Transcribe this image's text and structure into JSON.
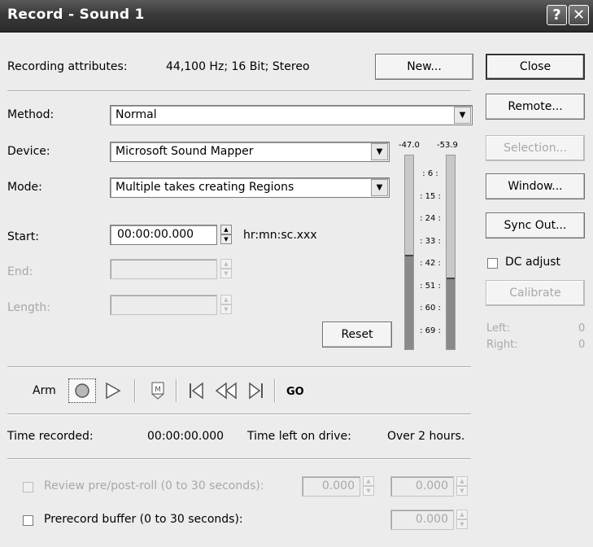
{
  "window": {
    "title": "Record - Sound 1",
    "help_glyph": "?",
    "close_glyph": "✕"
  },
  "attributes": {
    "label": "Recording attributes:",
    "value": "44,100 Hz; 16 Bit; Stereo",
    "new_button": "New..."
  },
  "form": {
    "method_label": "Method:",
    "method_value": "Normal",
    "device_label": "Device:",
    "device_value": "Microsoft Sound Mapper",
    "mode_label": "Mode:",
    "mode_value": "Multiple takes creating Regions",
    "start_label": "Start:",
    "start_value": "00:00:00.000",
    "time_format": "hr:mn:sc.xxx",
    "end_label": "End:",
    "end_value": "",
    "length_label": "Length:",
    "length_value": "",
    "reset_button": "Reset"
  },
  "meters": {
    "left_peak": "-47.0",
    "right_peak": "-53.9",
    "scale": [
      "6",
      "15",
      "24",
      "33",
      "42",
      "51",
      "60",
      "69"
    ],
    "left_level": 0.48,
    "right_level": 0.36
  },
  "side": {
    "close": "Close",
    "remote": "Remote...",
    "selection": "Selection...",
    "window": "Window...",
    "sync_out": "Sync Out...",
    "dc_adjust": "DC adjust",
    "calibrate": "Calibrate",
    "left_label": "Left:",
    "left_value": "0",
    "right_label": "Right:",
    "right_value": "0"
  },
  "transport": {
    "arm": "Arm",
    "go": "GO",
    "icons": [
      "record-icon",
      "play-icon",
      "marker-icon",
      "go-to-start-icon",
      "rewind-icon",
      "go-to-end-icon"
    ]
  },
  "status": {
    "time_recorded_label": "Time recorded:",
    "time_recorded_value": "00:00:00.000",
    "time_left_label": "Time left on drive:",
    "time_left_value": "Over 2 hours."
  },
  "options": {
    "review_label": "Review pre/post-roll (0 to 30 seconds):",
    "review_pre": "0.000",
    "review_post": "0.000",
    "prerecord_label": "Prerecord buffer (0 to 30 seconds):",
    "prerecord_value": "0.000"
  }
}
